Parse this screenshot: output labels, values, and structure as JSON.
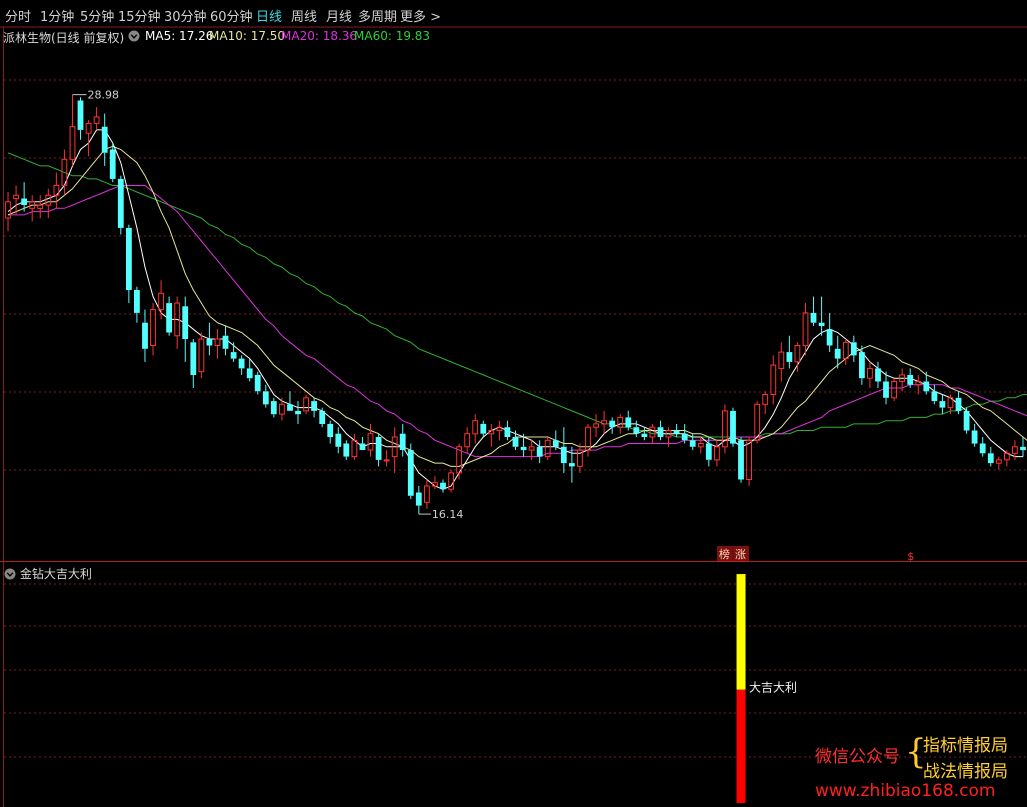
{
  "tabs": [
    "分时",
    "1分钟",
    "5分钟",
    "15分钟",
    "30分钟",
    "60分钟",
    "日线",
    "周线",
    "月线",
    "多周期",
    "更多 >"
  ],
  "active_tab": "日线",
  "info": {
    "stock_title": "派林生物(日线 前复权)",
    "ma5": "MA5: 17.26",
    "ma10": "MA10: 17.50",
    "ma20": "MA20: 18.36",
    "ma60": "MA60: 19.83"
  },
  "colors": {
    "up": "#ff3232",
    "down": "#54ffff",
    "ma5": "#ffffff",
    "ma10": "#e6e696",
    "ma20": "#dd33dd",
    "ma60": "#30b030",
    "grid": "#781e1e",
    "tab_active": "#3fd7e6",
    "ind_yellow": "#ffff00",
    "ind_red": "#ff0000"
  },
  "chart_data": {
    "type": "candlestick",
    "price_ylim": [
      15.5,
      30.5
    ],
    "high_label": "28.98",
    "low_label": "16.14",
    "ohlc": [
      [
        25.2,
        26.0,
        24.8,
        25.7
      ],
      [
        25.8,
        26.2,
        25.3,
        25.9
      ],
      [
        25.8,
        26.3,
        25.4,
        25.6
      ],
      [
        25.5,
        25.9,
        25.1,
        25.7
      ],
      [
        25.5,
        25.9,
        25.2,
        25.6
      ],
      [
        25.6,
        26.1,
        25.2,
        25.9
      ],
      [
        25.9,
        26.6,
        25.5,
        26.2
      ],
      [
        26.2,
        27.3,
        25.9,
        27.0
      ],
      [
        27.0,
        28.98,
        26.8,
        28.0
      ],
      [
        28.8,
        28.9,
        27.6,
        27.9
      ],
      [
        27.8,
        28.2,
        27.1,
        28.1
      ],
      [
        28.1,
        28.6,
        27.9,
        28.3
      ],
      [
        28.0,
        28.4,
        26.8,
        27.2
      ],
      [
        27.3,
        27.5,
        26.3,
        26.4
      ],
      [
        26.4,
        26.5,
        24.7,
        24.9
      ],
      [
        24.9,
        25.0,
        22.6,
        23.0
      ],
      [
        23.0,
        23.1,
        22.0,
        22.3
      ],
      [
        22.0,
        22.4,
        20.8,
        21.2
      ],
      [
        21.3,
        22.6,
        21.0,
        22.4
      ],
      [
        22.4,
        23.3,
        22.1,
        22.9
      ],
      [
        22.6,
        22.8,
        21.6,
        21.7
      ],
      [
        21.6,
        22.8,
        21.2,
        22.6
      ],
      [
        22.5,
        22.8,
        20.8,
        21.5
      ],
      [
        21.4,
        21.5,
        20.0,
        20.4
      ],
      [
        20.5,
        21.7,
        20.3,
        21.5
      ],
      [
        21.5,
        22.0,
        21.0,
        21.3
      ],
      [
        21.3,
        21.8,
        20.9,
        21.5
      ],
      [
        21.6,
        21.9,
        21.0,
        21.2
      ],
      [
        21.1,
        21.4,
        20.8,
        20.9
      ],
      [
        20.9,
        21.0,
        20.4,
        20.6
      ],
      [
        20.6,
        20.9,
        20.2,
        20.3
      ],
      [
        20.4,
        20.5,
        19.8,
        19.9
      ],
      [
        19.9,
        20.1,
        19.4,
        19.5
      ],
      [
        19.6,
        19.7,
        19.1,
        19.2
      ],
      [
        19.2,
        19.7,
        19.0,
        19.5
      ],
      [
        19.5,
        19.9,
        19.3,
        19.3
      ],
      [
        19.3,
        19.6,
        18.9,
        19.2
      ],
      [
        19.3,
        19.8,
        19.2,
        19.7
      ],
      [
        19.6,
        19.7,
        19.1,
        19.3
      ],
      [
        19.3,
        19.4,
        18.8,
        18.9
      ],
      [
        18.9,
        19.0,
        18.3,
        18.5
      ],
      [
        18.6,
        18.8,
        18.0,
        18.2
      ],
      [
        18.3,
        18.4,
        17.8,
        17.9
      ],
      [
        17.9,
        18.6,
        17.8,
        18.4
      ],
      [
        18.3,
        18.5,
        18.1,
        18.1
      ],
      [
        18.1,
        18.9,
        17.9,
        18.6
      ],
      [
        18.5,
        18.6,
        17.6,
        17.8
      ],
      [
        17.8,
        18.1,
        17.6,
        17.8
      ],
      [
        17.9,
        18.8,
        17.4,
        18.5
      ],
      [
        18.6,
        18.9,
        17.9,
        18.1
      ],
      [
        18.1,
        18.3,
        16.6,
        16.7
      ],
      [
        16.8,
        17.0,
        16.14,
        16.4
      ],
      [
        16.5,
        17.2,
        16.3,
        17.0
      ],
      [
        17.0,
        17.3,
        16.9,
        17.1
      ],
      [
        17.1,
        17.2,
        16.8,
        16.9
      ],
      [
        16.9,
        17.5,
        16.8,
        17.4
      ],
      [
        17.4,
        18.3,
        17.2,
        18.2
      ],
      [
        18.2,
        18.8,
        18.0,
        18.6
      ],
      [
        18.6,
        19.2,
        18.3,
        19.0
      ],
      [
        18.9,
        19.0,
        18.5,
        18.6
      ],
      [
        18.6,
        18.9,
        18.2,
        18.7
      ],
      [
        18.7,
        19.0,
        18.4,
        18.8
      ],
      [
        18.8,
        19.0,
        18.4,
        18.5
      ],
      [
        18.5,
        18.7,
        18.1,
        18.2
      ],
      [
        18.2,
        18.6,
        17.9,
        18.1
      ],
      [
        18.1,
        18.4,
        17.8,
        18.2
      ],
      [
        18.2,
        18.4,
        17.7,
        17.9
      ],
      [
        17.9,
        18.5,
        17.8,
        18.4
      ],
      [
        18.4,
        18.7,
        18.1,
        18.2
      ],
      [
        18.2,
        18.8,
        17.4,
        17.7
      ],
      [
        17.7,
        18.2,
        17.1,
        17.6
      ],
      [
        17.6,
        18.3,
        17.4,
        18.1
      ],
      [
        18.1,
        18.9,
        17.9,
        18.8
      ],
      [
        18.8,
        19.2,
        18.5,
        18.9
      ],
      [
        18.9,
        19.3,
        18.6,
        19.0
      ],
      [
        19.0,
        19.1,
        18.6,
        18.8
      ],
      [
        18.8,
        19.2,
        18.6,
        19.1
      ],
      [
        19.1,
        19.3,
        18.7,
        18.8
      ],
      [
        18.8,
        19.0,
        18.5,
        18.6
      ],
      [
        18.6,
        18.8,
        18.4,
        18.5
      ],
      [
        18.5,
        18.9,
        18.3,
        18.8
      ],
      [
        18.8,
        19.0,
        18.4,
        18.5
      ],
      [
        18.5,
        18.8,
        18.2,
        18.7
      ],
      [
        18.7,
        18.9,
        18.5,
        18.6
      ],
      [
        18.6,
        18.9,
        18.3,
        18.4
      ],
      [
        18.4,
        18.6,
        18.1,
        18.2
      ],
      [
        18.2,
        18.5,
        18.0,
        18.3
      ],
      [
        18.3,
        18.5,
        17.6,
        17.8
      ],
      [
        17.8,
        18.4,
        17.6,
        18.2
      ],
      [
        18.2,
        19.5,
        18.0,
        19.3
      ],
      [
        19.3,
        19.4,
        18.2,
        18.3
      ],
      [
        18.4,
        18.5,
        17.1,
        17.2
      ],
      [
        17.2,
        18.5,
        17.0,
        18.4
      ],
      [
        18.4,
        19.6,
        18.3,
        19.5
      ],
      [
        19.5,
        19.9,
        19.2,
        19.8
      ],
      [
        19.8,
        21.0,
        19.5,
        20.7
      ],
      [
        20.6,
        21.4,
        20.2,
        21.1
      ],
      [
        21.1,
        21.6,
        20.6,
        20.8
      ],
      [
        20.8,
        21.4,
        20.5,
        21.3
      ],
      [
        21.3,
        22.6,
        21.0,
        22.3
      ],
      [
        22.3,
        22.8,
        21.9,
        22.0
      ],
      [
        22.0,
        22.8,
        21.6,
        21.9
      ],
      [
        21.8,
        22.3,
        21.1,
        21.3
      ],
      [
        21.2,
        21.6,
        20.6,
        20.9
      ],
      [
        20.9,
        21.5,
        20.7,
        21.4
      ],
      [
        21.4,
        21.6,
        20.8,
        21.0
      ],
      [
        21.1,
        21.3,
        20.1,
        20.3
      ],
      [
        20.3,
        20.8,
        20.0,
        20.6
      ],
      [
        20.6,
        20.8,
        20.0,
        20.2
      ],
      [
        20.2,
        20.5,
        19.5,
        19.7
      ],
      [
        19.7,
        20.3,
        19.6,
        20.2
      ],
      [
        20.2,
        20.6,
        19.9,
        20.4
      ],
      [
        20.4,
        20.6,
        20.0,
        20.1
      ],
      [
        20.1,
        20.4,
        19.8,
        20.2
      ],
      [
        20.2,
        20.5,
        19.8,
        19.9
      ],
      [
        19.9,
        20.1,
        19.5,
        19.6
      ],
      [
        19.6,
        19.8,
        19.2,
        19.4
      ],
      [
        19.4,
        19.8,
        19.2,
        19.7
      ],
      [
        19.7,
        19.9,
        19.2,
        19.3
      ],
      [
        19.3,
        19.4,
        18.6,
        18.7
      ],
      [
        18.7,
        18.9,
        18.2,
        18.3
      ],
      [
        18.3,
        18.5,
        17.9,
        18.0
      ],
      [
        18.0,
        18.2,
        17.6,
        17.7
      ],
      [
        17.7,
        17.9,
        17.5,
        17.8
      ],
      [
        17.8,
        18.1,
        17.6,
        18.0
      ],
      [
        18.0,
        18.4,
        17.8,
        18.2
      ],
      [
        18.2,
        18.5,
        17.9,
        18.1
      ]
    ],
    "ma5": [
      25.4,
      25.6,
      25.7,
      25.7,
      25.7,
      25.8,
      25.9,
      26.2,
      26.8,
      27.3,
      27.5,
      27.9,
      27.9,
      27.5,
      26.9,
      25.9,
      24.9,
      23.7,
      22.8,
      22.3,
      22.1,
      22.1,
      22.0,
      21.8,
      21.6,
      21.5,
      21.5,
      21.5,
      21.3,
      21.1,
      20.9,
      20.6,
      20.2,
      19.8,
      19.6,
      19.5,
      19.4,
      19.4,
      19.4,
      19.3,
      19.1,
      18.9,
      18.6,
      18.4,
      18.2,
      18.3,
      18.3,
      18.2,
      18.2,
      18.2,
      17.8,
      17.4,
      17.2,
      17.0,
      16.9,
      17.0,
      17.4,
      17.8,
      18.2,
      18.5,
      18.7,
      18.8,
      18.7,
      18.6,
      18.5,
      18.4,
      18.2,
      18.2,
      18.2,
      18.1,
      18.0,
      18.0,
      18.1,
      18.3,
      18.6,
      18.8,
      18.9,
      18.9,
      18.9,
      18.8,
      18.7,
      18.6,
      18.6,
      18.6,
      18.6,
      18.5,
      18.5,
      18.3,
      18.2,
      18.4,
      18.4,
      18.2,
      18.3,
      18.5,
      18.8,
      19.2,
      19.7,
      20.3,
      20.7,
      21.1,
      21.5,
      21.7,
      21.8,
      21.7,
      21.5,
      21.3,
      21.1,
      20.8,
      20.6,
      20.4,
      20.3,
      20.3,
      20.3,
      20.2,
      20.1,
      19.9,
      19.8,
      19.7,
      19.5,
      19.3,
      19.0,
      18.7,
      18.4,
      18.2,
      18.0,
      17.9,
      17.9
    ],
    "ma10": [
      25.3,
      25.4,
      25.5,
      25.6,
      25.6,
      25.7,
      25.7,
      25.9,
      26.1,
      26.4,
      26.7,
      27.0,
      27.3,
      27.4,
      27.3,
      27.1,
      26.9,
      26.5,
      26.0,
      25.4,
      24.9,
      24.2,
      23.5,
      23.0,
      22.6,
      22.2,
      22.0,
      21.9,
      21.8,
      21.7,
      21.5,
      21.3,
      21.0,
      20.7,
      20.5,
      20.3,
      20.1,
      19.9,
      19.7,
      19.6,
      19.4,
      19.3,
      19.1,
      19.0,
      18.8,
      18.7,
      18.6,
      18.4,
      18.3,
      18.2,
      18.1,
      17.9,
      17.8,
      17.7,
      17.7,
      17.6,
      17.6,
      17.7,
      17.8,
      17.9,
      18.0,
      18.2,
      18.3,
      18.5,
      18.5,
      18.5,
      18.5,
      18.5,
      18.4,
      18.3,
      18.3,
      18.2,
      18.2,
      18.2,
      18.3,
      18.4,
      18.5,
      18.6,
      18.6,
      18.7,
      18.7,
      18.7,
      18.7,
      18.7,
      18.7,
      18.6,
      18.6,
      18.5,
      18.4,
      18.4,
      18.5,
      18.4,
      18.4,
      18.4,
      18.5,
      18.6,
      18.8,
      19.1,
      19.4,
      19.6,
      19.9,
      20.2,
      20.5,
      20.7,
      20.9,
      21.1,
      21.2,
      21.3,
      21.2,
      21.1,
      21.0,
      20.8,
      20.7,
      20.6,
      20.4,
      20.3,
      20.2,
      20.0,
      19.9,
      19.8,
      19.6,
      19.4,
      19.3,
      19.1,
      18.9,
      18.7,
      18.5,
      18.3
    ],
    "ma20": [
      25.3,
      25.3,
      25.3,
      25.4,
      25.4,
      25.4,
      25.5,
      25.5,
      25.6,
      25.7,
      25.8,
      25.9,
      26.0,
      26.1,
      26.2,
      26.2,
      26.2,
      26.2,
      26.0,
      25.8,
      25.6,
      25.4,
      25.1,
      24.8,
      24.5,
      24.2,
      23.9,
      23.6,
      23.3,
      23.0,
      22.7,
      22.4,
      22.1,
      21.9,
      21.6,
      21.4,
      21.2,
      21.0,
      20.9,
      20.7,
      20.5,
      20.3,
      20.1,
      20.0,
      19.8,
      19.6,
      19.5,
      19.3,
      19.2,
      19.0,
      18.9,
      18.7,
      18.6,
      18.4,
      18.3,
      18.2,
      18.1,
      18.0,
      17.9,
      17.9,
      17.9,
      17.9,
      17.9,
      17.9,
      17.9,
      17.9,
      17.9,
      18.0,
      18.0,
      18.0,
      18.1,
      18.1,
      18.1,
      18.1,
      18.2,
      18.2,
      18.2,
      18.3,
      18.3,
      18.3,
      18.3,
      18.3,
      18.3,
      18.3,
      18.4,
      18.4,
      18.4,
      18.4,
      18.4,
      18.4,
      18.5,
      18.5,
      18.5,
      18.5,
      18.5,
      18.6,
      18.6,
      18.7,
      18.8,
      18.9,
      19.0,
      19.1,
      19.3,
      19.4,
      19.5,
      19.6,
      19.7,
      19.8,
      19.9,
      20.0,
      20.0,
      20.0,
      20.1,
      20.1,
      20.1,
      20.1,
      20.1,
      20.0,
      20.0,
      19.9,
      19.8,
      19.7,
      19.6,
      19.5,
      19.4,
      19.3,
      19.2,
      19.1,
      19.0
    ],
    "ma60": [
      27.2,
      27.1,
      27.0,
      26.9,
      26.8,
      26.8,
      26.7,
      26.6,
      26.5,
      26.5,
      26.4,
      26.4,
      26.3,
      26.2,
      26.2,
      26.1,
      26.0,
      25.9,
      25.8,
      25.7,
      25.6,
      25.5,
      25.4,
      25.3,
      25.2,
      25.0,
      24.9,
      24.7,
      24.6,
      24.4,
      24.3,
      24.1,
      24.0,
      23.8,
      23.7,
      23.5,
      23.4,
      23.2,
      23.1,
      22.9,
      22.8,
      22.6,
      22.5,
      22.3,
      22.2,
      22.0,
      21.9,
      21.8,
      21.6,
      21.5,
      21.4,
      21.2,
      21.1,
      21.0,
      20.9,
      20.8,
      20.7,
      20.6,
      20.5,
      20.4,
      20.3,
      20.2,
      20.1,
      20.0,
      19.9,
      19.8,
      19.7,
      19.6,
      19.5,
      19.4,
      19.3,
      19.2,
      19.1,
      19.0,
      18.9,
      18.9,
      18.8,
      18.8,
      18.7,
      18.7,
      18.6,
      18.6,
      18.6,
      18.5,
      18.5,
      18.5,
      18.5,
      18.5,
      18.5,
      18.5,
      18.5,
      18.5,
      18.5,
      18.5,
      18.6,
      18.6,
      18.6,
      18.6,
      18.7,
      18.7,
      18.7,
      18.8,
      18.8,
      18.8,
      18.8,
      18.9,
      18.9,
      18.9,
      18.9,
      19.0,
      19.0,
      19.0,
      19.1,
      19.1,
      19.1,
      19.2,
      19.2,
      19.3,
      19.3,
      19.4,
      19.5,
      19.5,
      19.6,
      19.6,
      19.7,
      19.7,
      19.8,
      19.8,
      19.8
    ],
    "markers": [
      {
        "index": 89,
        "text": "榜"
      },
      {
        "index": 91,
        "text": "涨"
      },
      {
        "index": 112,
        "text": "$"
      }
    ],
    "indicator": {
      "title": "金钻大吉大利",
      "label": "大吉大利",
      "bar_index": 91,
      "bar_top_fraction": 0.95,
      "bar_split_fraction": 0.47
    }
  },
  "watermark": {
    "wechat": "微信公众号",
    "brace": "{",
    "line1": "指标情报局",
    "line2": "战法情报局",
    "url": "www.zhibiao168.com"
  }
}
